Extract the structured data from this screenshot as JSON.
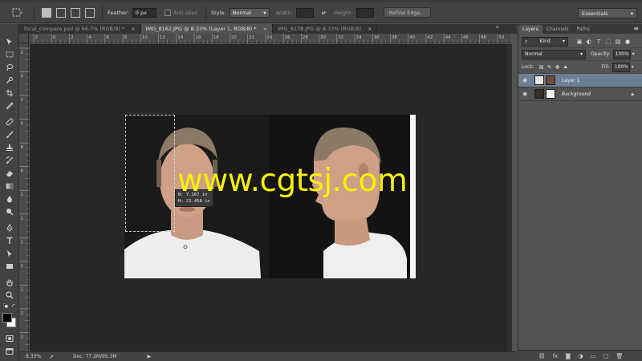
{
  "options_bar": {
    "feather_label": "Feather:",
    "feather_value": "0 px",
    "anti_alias_label": "Anti-alias",
    "style_label": "Style:",
    "style_value": "Normal",
    "width_label": "Width:",
    "height_label": "Height:",
    "refine_edge_label": "Refine Edge...",
    "workspace_value": "Essentials"
  },
  "document_tabs": [
    {
      "label": "focal_compare.psd @ 66.7% (RGB/8) *",
      "close": "×"
    },
    {
      "label": "IMG_8162.JPG @ 8.33% (Layer 1, RGB/8) *",
      "close": "×"
    },
    {
      "label": "IMG_8178.JPG @ 8.33% (RGB/8)",
      "close": "×"
    }
  ],
  "tabs_overflow": "»",
  "ruler_top_labels": [
    "2",
    "0",
    "2",
    "4",
    "6",
    "8",
    "10",
    "12",
    "14",
    "16",
    "18",
    "20",
    "22",
    "24",
    "26",
    "28",
    "30",
    "32",
    "34",
    "36",
    "38",
    "40",
    "42",
    "44",
    "46",
    "48",
    "50"
  ],
  "ruler_left_labels": [
    "2",
    "0",
    "2",
    "4",
    "6",
    "8",
    "1",
    "1",
    "1",
    "1",
    "1",
    "2",
    "2"
  ],
  "measurement": {
    "width_line": "W:    7.167 in",
    "height_line": "H:   21.458 in"
  },
  "watermark_text": "www.cgtsj.com",
  "status_bar": {
    "zoom": "8.33%",
    "doc_info": "Doc: 77.2M/95.3M",
    "arrow": "▶"
  },
  "layers_panel": {
    "tabs": [
      "Layers",
      "Channels",
      "Paths"
    ],
    "active_tab": "Layers",
    "menu_icon": "≡",
    "filter_kind": "Kind",
    "blend_mode": "Normal",
    "opacity_label": "Opacity:",
    "opacity_value": "100%",
    "lock_label": "Lock:",
    "fill_label": "Fill:",
    "fill_value": "100%",
    "layers": [
      {
        "name": "Layer 1",
        "selected": true,
        "has_lock": false
      },
      {
        "name": "Background",
        "selected": false,
        "has_lock": true
      }
    ]
  },
  "colors": {
    "ui_dark": "#424242",
    "canvas_bg": "#272727",
    "watermark": "#f6f200",
    "selected_layer": "#6b7f95"
  }
}
